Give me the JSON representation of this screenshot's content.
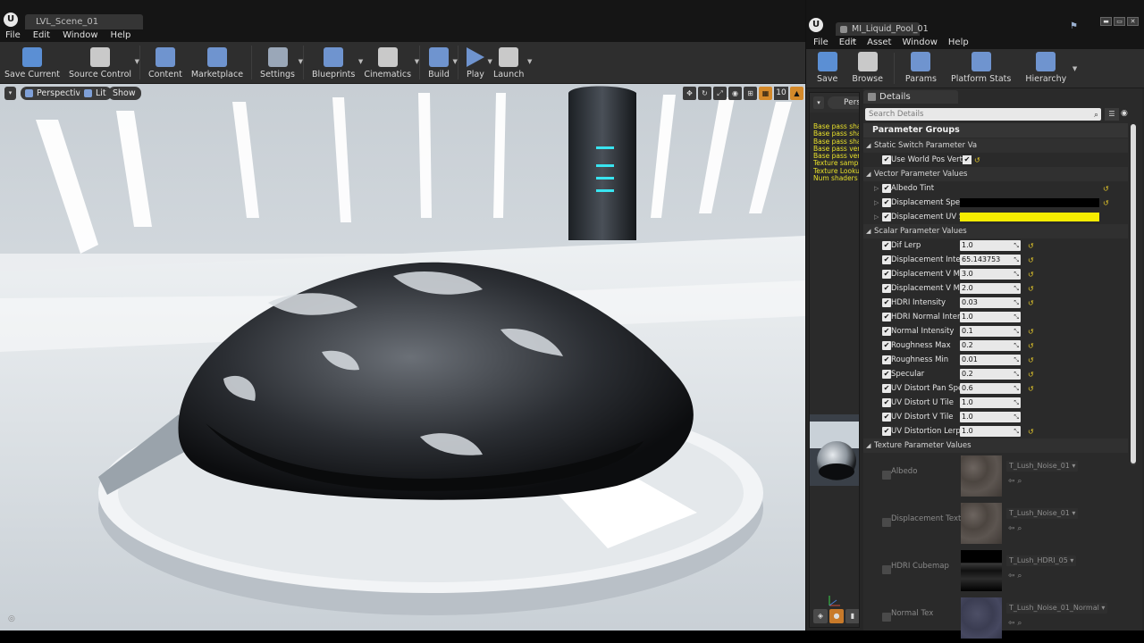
{
  "editor": {
    "logo": "U",
    "tab_title": "LVL_Scene_01",
    "menu": [
      "File",
      "Edit",
      "Window",
      "Help"
    ],
    "toolbar": [
      {
        "id": "save-current",
        "label": "Save Current",
        "icon": "save-icon",
        "color": "#5b8fd4"
      },
      {
        "id": "source-control",
        "label": "Source Control",
        "icon": "source-control-icon",
        "color": "#c9c9c9"
      },
      {
        "id": "content",
        "label": "Content",
        "icon": "content-icon",
        "color": "#6f94cf"
      },
      {
        "id": "marketplace",
        "label": "Marketplace",
        "icon": "marketplace-icon",
        "color": "#6f94cf"
      },
      {
        "id": "settings",
        "label": "Settings",
        "icon": "settings-icon",
        "color": "#9aa7b8"
      },
      {
        "id": "blueprints",
        "label": "Blueprints",
        "icon": "blueprints-icon",
        "color": "#6f94cf"
      },
      {
        "id": "cinematics",
        "label": "Cinematics",
        "icon": "cinematics-icon",
        "color": "#c9c9c9"
      },
      {
        "id": "build",
        "label": "Build",
        "icon": "build-icon",
        "color": "#6f94cf"
      },
      {
        "id": "play",
        "label": "Play",
        "icon": "play-icon",
        "color": "#6f94cf"
      },
      {
        "id": "launch",
        "label": "Launch",
        "icon": "launch-icon",
        "color": "#c9c9c9"
      }
    ],
    "viewport": {
      "menu_icon": "▾",
      "perspective": "Perspective",
      "lit": "Lit",
      "show": "Show",
      "right_icons": [
        "✥",
        "↻",
        "⤢",
        "◉",
        "⊞",
        "▦"
      ],
      "grid_snap_value": "10",
      "camera_speed_icon": "▲",
      "corner_text": "◎"
    }
  },
  "material_editor": {
    "logo": "U",
    "tab_title": "MI_Liquid_Pool_01",
    "tab_modified": "*",
    "window_controls": [
      "▬",
      "▭",
      "✕"
    ],
    "menu": [
      "File",
      "Edit",
      "Asset",
      "Window",
      "Help"
    ],
    "toolbar": [
      {
        "id": "save",
        "label": "Save",
        "icon": "save-icon",
        "color": "#5b8fd4"
      },
      {
        "id": "browse",
        "label": "Browse",
        "icon": "browse-icon",
        "color": "#c9c9c9"
      },
      {
        "id": "params",
        "label": "Params",
        "icon": "params-icon",
        "color": "#6f94cf"
      },
      {
        "id": "platform-stats",
        "label": "Platform Stats",
        "icon": "platform-stats-icon",
        "color": "#6f94cf"
      },
      {
        "id": "hierarchy",
        "label": "Hierarchy",
        "icon": "hierarchy-icon",
        "color": "#6f94cf"
      }
    ],
    "preview": {
      "chip": "Pers",
      "stats": [
        "Base pass sha",
        "Base pass sha",
        "Base pass sha",
        "Base pass vert",
        "Base pass vert",
        "Texture sample",
        "Texture Lookup",
        "Num shaders a"
      ],
      "foot_icons": [
        "◈",
        "●",
        "▮"
      ]
    },
    "details": {
      "tab": "Details",
      "search_placeholder": "Search Details",
      "header": "Parameter Groups",
      "groups": {
        "static_switch": "Static Switch Parameter Va",
        "vector": "Vector Parameter Values",
        "scalar": "Scalar Parameter Values",
        "texture": "Texture Parameter Values"
      },
      "static_switch": [
        {
          "name": "Use World Pos Vert",
          "checked": true,
          "value_checked": true
        }
      ],
      "vector": [
        {
          "name": "Albedo Tint",
          "color": ""
        },
        {
          "name": "Displacement Speed",
          "color": "#000000"
        },
        {
          "name": "Displacement UV Sca",
          "color": "#f5ec00"
        }
      ],
      "scalar": [
        {
          "name": "Dif Lerp",
          "value": "1.0",
          "reset": true
        },
        {
          "name": "Displacement Intensit",
          "value": "65.143753",
          "reset": true
        },
        {
          "name": "Displacement V Mask",
          "value": "3.0",
          "reset": true
        },
        {
          "name": "Displacement V Mask",
          "value": "2.0",
          "reset": true
        },
        {
          "name": "HDRI Intensity",
          "value": "0.03",
          "reset": true
        },
        {
          "name": "HDRI Normal Intensity",
          "value": "1.0",
          "reset": false
        },
        {
          "name": "Normal Intensity",
          "value": "0.1",
          "reset": true
        },
        {
          "name": "Roughness Max",
          "value": "0.2",
          "reset": true
        },
        {
          "name": "Roughness Min",
          "value": "0.01",
          "reset": true
        },
        {
          "name": "Specular",
          "value": "0.2",
          "reset": true
        },
        {
          "name": "UV Distort Pan Speed",
          "value": "0.6",
          "reset": true
        },
        {
          "name": "UV Distort U Tile",
          "value": "1.0",
          "reset": false
        },
        {
          "name": "UV Distort V Tile",
          "value": "1.0",
          "reset": false
        },
        {
          "name": "UV Distortion Lerp",
          "value": "1.0",
          "reset": true
        }
      ],
      "texture": [
        {
          "name": "Albedo",
          "asset": "T_Lush_Noise_01",
          "kind": "noise"
        },
        {
          "name": "Displacement Texture",
          "asset": "T_Lush_Noise_01",
          "kind": "noise"
        },
        {
          "name": "HDRI Cubemap",
          "asset": "T_Lush_HDRI_05",
          "kind": "cubemap"
        },
        {
          "name": "Normal Tex",
          "asset": "T_Lush_Noise_01_Normal",
          "kind": "normal"
        }
      ]
    }
  },
  "colors": {
    "accent_orange": "#d4892a",
    "reset_yellow": "#e6c92a",
    "stats_yellow": "#e9e12a"
  }
}
